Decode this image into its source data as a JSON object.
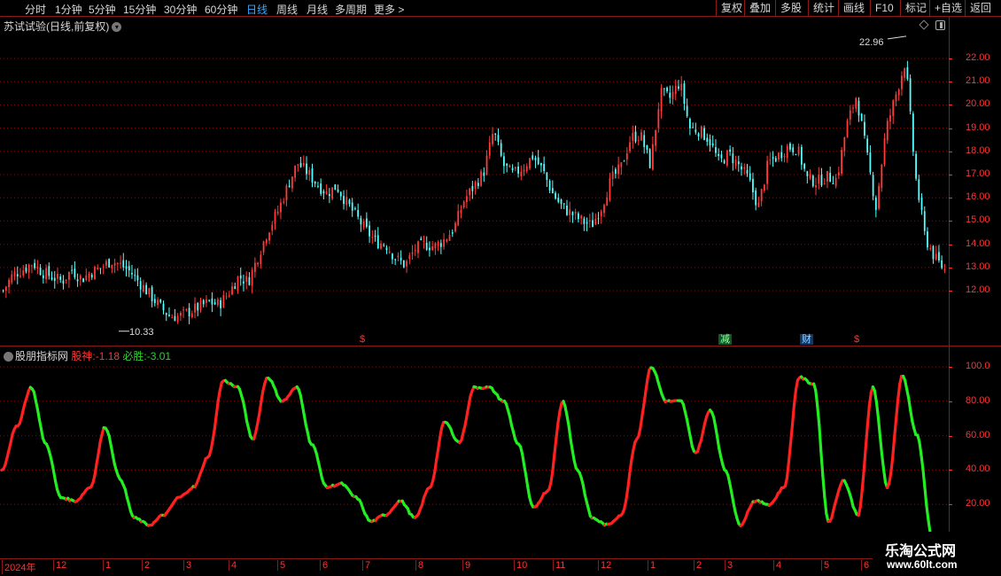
{
  "toolbar": {
    "periods": [
      {
        "label": "分时",
        "active": false
      },
      {
        "label": "1分钟",
        "active": false
      },
      {
        "label": "5分钟",
        "active": false
      },
      {
        "label": "15分钟",
        "active": false
      },
      {
        "label": "30分钟",
        "active": false
      },
      {
        "label": "60分钟",
        "active": false
      },
      {
        "label": "日线",
        "active": true
      },
      {
        "label": "周线",
        "active": false
      },
      {
        "label": "月线",
        "active": false
      },
      {
        "label": "多周期",
        "active": false
      },
      {
        "label": "更多 >",
        "active": false
      }
    ],
    "right_buttons": [
      "复权",
      "叠加",
      "多股",
      "统计",
      "画线",
      "F10",
      "标记",
      "+自选",
      "返回"
    ]
  },
  "chart": {
    "title": "苏试试验(日线,前复权)",
    "high_marker": "22.96",
    "low_marker": "10.33",
    "price_axis": [
      "22.00",
      "21.00",
      "20.00",
      "19.00",
      "18.00",
      "17.00",
      "16.00",
      "15.00",
      "14.00",
      "13.00",
      "12.00"
    ]
  },
  "indicator": {
    "name": "股朋指标网",
    "label1": "股神:",
    "value1": "-1.18",
    "label2": "必胜:",
    "value2": "-3.01",
    "axis": [
      "100.0",
      "80.00",
      "60.00",
      "40.00",
      "20.00"
    ]
  },
  "event_tags": [
    {
      "text": "$",
      "style": "s"
    },
    {
      "text": "减",
      "style": "green"
    },
    {
      "text": "财",
      "style": "blue"
    },
    {
      "text": "$",
      "style": "s"
    }
  ],
  "date_axis": [
    "2024年",
    "12",
    "1",
    "2",
    "3",
    "4",
    "5",
    "6",
    "7",
    "8",
    "9",
    "10",
    "11",
    "12",
    "1",
    "2",
    "3",
    "4",
    "5",
    "6"
  ],
  "watermark": {
    "title": "乐淘公式网",
    "url": "www.60lt.com"
  },
  "colors": {
    "up": "#ff3b3b",
    "down": "#55ffff",
    "line_up": "#ff2020",
    "line_down": "#22ee22",
    "grid": "#7a1010"
  },
  "chart_data": [
    {
      "type": "candlestick",
      "title": "苏试试验(日线,前复权)",
      "ylim": [
        11.2,
        23.0
      ],
      "y_ticks": [
        12,
        13,
        14,
        15,
        16,
        17,
        18,
        19,
        20,
        21,
        22
      ],
      "annotations": [
        {
          "label": "22.96",
          "kind": "high"
        },
        {
          "label": "10.33",
          "kind": "low"
        }
      ],
      "close_series": [
        12.0,
        12.7,
        12.9,
        13.2,
        12.8,
        12.6,
        12.4,
        12.9,
        12.5,
        12.8,
        13.0,
        13.3,
        13.1,
        12.8,
        12.3,
        11.8,
        11.3,
        10.9,
        10.9,
        11.1,
        11.3,
        11.5,
        11.4,
        11.9,
        12.6,
        12.4,
        13.5,
        14.6,
        15.4,
        16.5,
        17.5,
        17.1,
        16.6,
        16.2,
        16.5,
        15.8,
        15.2,
        14.6,
        14.1,
        14.0,
        13.4,
        13.1,
        13.8,
        14.0,
        13.9,
        14.2,
        14.7,
        15.9,
        16.5,
        17.1,
        18.9,
        17.4,
        17.0,
        17.3,
        17.8,
        17.2,
        16.2,
        15.6,
        15.3,
        15.0,
        14.8,
        15.6,
        16.8,
        17.3,
        18.6,
        18.7,
        17.4,
        20.5,
        20.3,
        21.0,
        19.0,
        18.9,
        18.5,
        17.5,
        17.9,
        17.4,
        16.8,
        15.6,
        17.5,
        17.8,
        18.2,
        18.1,
        16.8,
        16.7,
        16.9,
        16.8,
        19.1,
        20.4,
        18.0,
        15.6,
        18.9,
        20.4,
        21.9,
        17.0,
        14.3,
        13.4,
        12.9
      ]
    },
    {
      "type": "line",
      "title": "股朋指标网",
      "ylim": [
        0,
        105
      ],
      "y_ticks": [
        20,
        40,
        60,
        80,
        100
      ],
      "series": [
        {
          "name": "股神",
          "last": -1.18
        },
        {
          "name": "必胜",
          "last": -3.01
        }
      ],
      "values": [
        40,
        65,
        88,
        55,
        24,
        22,
        30,
        65,
        35,
        12,
        8,
        14,
        24,
        30,
        48,
        92,
        88,
        58,
        94,
        80,
        88,
        55,
        30,
        32,
        24,
        10,
        14,
        22,
        12,
        30,
        68,
        56,
        88,
        88,
        80,
        55,
        18,
        28,
        80,
        40,
        12,
        8,
        14,
        58,
        100,
        80,
        80,
        50,
        75,
        40,
        8,
        22,
        20,
        30,
        94,
        90,
        10,
        34,
        14,
        88,
        30,
        95,
        60,
        2
      ]
    }
  ]
}
